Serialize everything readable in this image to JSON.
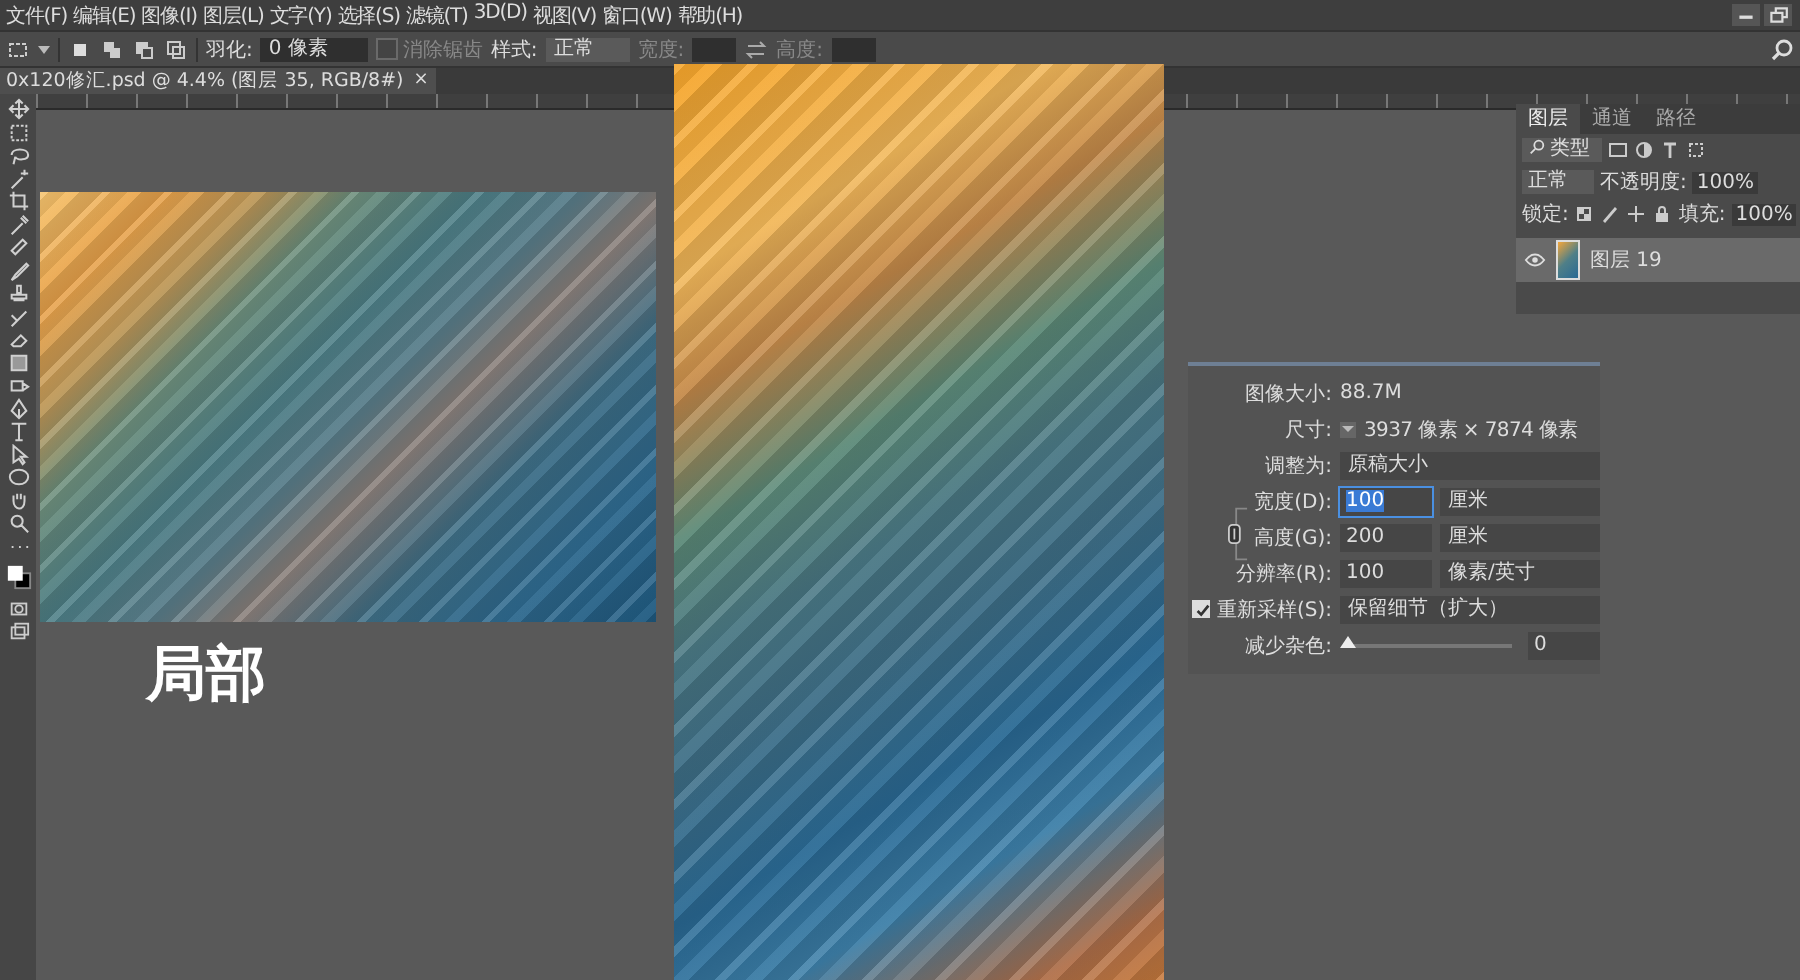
{
  "menu_bar": {
    "items": [
      "文件(F)",
      "编辑(E)",
      "图像(I)",
      "图层(L)",
      "文字(Y)",
      "选择(S)",
      "滤镜(T)",
      "3D(D)",
      "视图(V)",
      "窗口(W)",
      "帮助(H)"
    ]
  },
  "options_bar": {
    "feather_label": "羽化:",
    "feather_value": "0 像素",
    "antialias": {
      "label": "消除锯齿",
      "checked": false,
      "disabled": true
    },
    "style_label": "样式:",
    "style_value": "正常",
    "width_label": "宽度:",
    "height_label": "高度:"
  },
  "document_tab": {
    "title": "0x120修汇.psd @ 4.4% (图层 35, RGB/8#)",
    "close": "×"
  },
  "canvas": {
    "caption": "局部"
  },
  "layers_panel": {
    "tabs": [
      {
        "label": "图层",
        "selected": true
      },
      {
        "label": "通道",
        "selected": false
      },
      {
        "label": "路径",
        "selected": false
      }
    ],
    "filter": "类型",
    "blend_mode": "正常",
    "opacity_label": "不透明度:",
    "opacity": "100%",
    "lock_label": "锁定:",
    "fill_label": "填充:",
    "fill": "100%",
    "layers": [
      {
        "name": "图层 19",
        "visible": true,
        "selected": true
      }
    ]
  },
  "image_size_dialog": {
    "image_size_label": "图像大小:",
    "image_size": "88.7M",
    "dimensions_label": "尺寸:",
    "dimensions": "3937 像素 × 7874 像素",
    "fit_label": "调整为:",
    "fit_value": "原稿大小",
    "fields": [
      {
        "label": "宽度(D):",
        "value": "100",
        "unit": "厘米",
        "focused": true
      },
      {
        "label": "高度(G):",
        "value": "200",
        "unit": "厘米",
        "focused": false
      },
      {
        "label": "分辨率(R):",
        "value": "100",
        "unit": "像素/英寸",
        "focused": false
      }
    ],
    "resample": {
      "label": "重新采样(S):",
      "checked": true,
      "value": "保留细节（扩大）"
    },
    "noise": {
      "label": "减少杂色:",
      "level": 0,
      "value": "0"
    }
  }
}
